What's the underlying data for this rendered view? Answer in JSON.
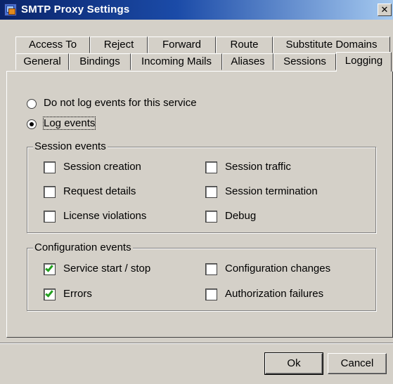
{
  "window": {
    "title": "SMTP Proxy Settings",
    "close_glyph": "✕"
  },
  "tabs_row1": [
    "Access To",
    "Reject",
    "Forward",
    "Route",
    "Substitute Domains"
  ],
  "tabs_row2": [
    "General",
    "Bindings",
    "Incoming Mails",
    "Aliases",
    "Sessions",
    "Logging"
  ],
  "active_tab": "Logging",
  "logging": {
    "radio_no_log": {
      "label": "Do not log events for this service",
      "checked": false
    },
    "radio_log": {
      "label": "Log events",
      "checked": true
    },
    "session_events": {
      "title": "Session events",
      "items": [
        {
          "label": "Session creation",
          "checked": false
        },
        {
          "label": "Session traffic",
          "checked": false
        },
        {
          "label": "Request details",
          "checked": false
        },
        {
          "label": "Session termination",
          "checked": false
        },
        {
          "label": "License violations",
          "checked": false
        },
        {
          "label": "Debug",
          "checked": false
        }
      ]
    },
    "configuration_events": {
      "title": "Configuration events",
      "items": [
        {
          "label": "Service start / stop",
          "checked": true
        },
        {
          "label": "Configuration changes",
          "checked": false
        },
        {
          "label": "Errors",
          "checked": true
        },
        {
          "label": "Authorization failures",
          "checked": false
        }
      ]
    }
  },
  "buttons": {
    "ok": "Ok",
    "cancel": "Cancel"
  },
  "colors": {
    "titlebar_start": "#0a246a",
    "titlebar_end": "#a6caf0",
    "check_mark": "#23a020",
    "face": "#d4d0c8"
  }
}
